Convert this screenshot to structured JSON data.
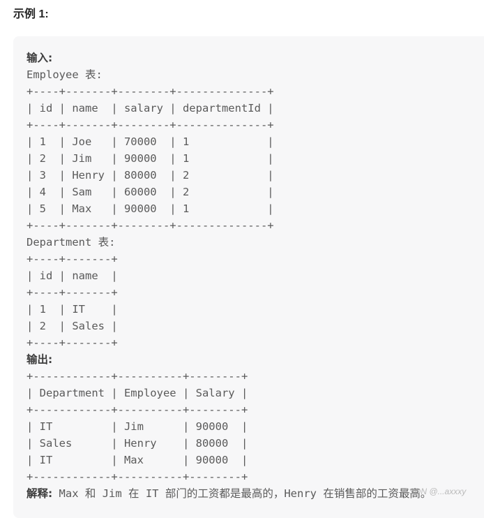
{
  "heading": "示例 1:",
  "input_label": "输入:",
  "employee_title": "Employee 表:",
  "employee_table": {
    "border": "+----+-------+--------+--------------+",
    "header": "| id | name  | salary | departmentId |",
    "rows": [
      "| 1  | Joe   | 70000  | 1            |",
      "| 2  | Jim   | 90000  | 1            |",
      "| 3  | Henry | 80000  | 2            |",
      "| 4  | Sam   | 60000  | 2            |",
      "| 5  | Max   | 90000  | 1            |"
    ]
  },
  "department_title": "Department 表:",
  "department_table": {
    "border": "+----+-------+",
    "header": "| id | name  |",
    "rows": [
      "| 1  | IT    |",
      "| 2  | Sales |"
    ]
  },
  "output_label": "输出:",
  "output_table": {
    "border": "+------------+----------+--------+",
    "header": "| Department | Employee | Salary |",
    "rows": [
      "| IT         | Jim      | 90000  |",
      "| Sales      | Henry    | 80000  |",
      "| IT         | Max      | 90000  |"
    ]
  },
  "explanation_label": "解释:",
  "explanation_text": " Max 和 Jim 在 IT 部门的工资都是最高的，Henry 在销售部的工资最高。",
  "watermark": "CSDN @...axxxy"
}
